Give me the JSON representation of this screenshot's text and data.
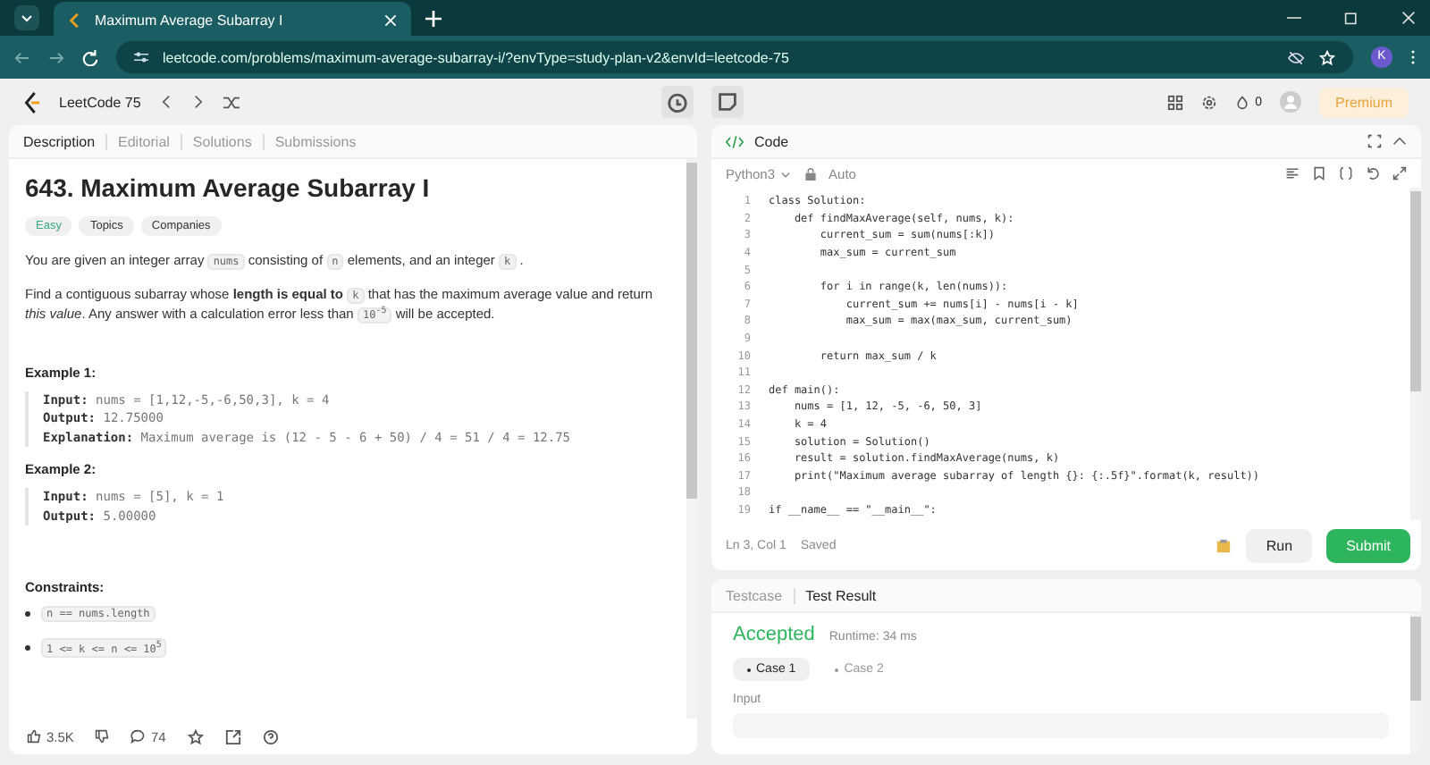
{
  "browser": {
    "tab_title": "Maximum Average Subarray I",
    "url": "leetcode.com/problems/maximum-average-subarray-i/?envType=study-plan-v2&envId=leetcode-75",
    "profile_initial": "K"
  },
  "nav": {
    "list_name": "LeetCode 75",
    "streak": "0",
    "premium": "Premium"
  },
  "left_tabs": [
    {
      "label": "Description",
      "selected": true
    },
    {
      "label": "Editorial",
      "selected": false
    },
    {
      "label": "Solutions",
      "selected": false
    },
    {
      "label": "Submissions",
      "selected": false
    }
  ],
  "problem": {
    "title": "643. Maximum Average Subarray I",
    "difficulty": "Easy",
    "tags": [
      "Topics",
      "Companies"
    ],
    "paragraphs": [
      [
        {
          "kind": "text",
          "text": "You are given an integer array"
        },
        {
          "kind": "code",
          "text": "nums"
        },
        {
          "kind": "text",
          "text": "consisting of"
        },
        {
          "kind": "code",
          "text": "n"
        },
        {
          "kind": "text",
          "text": "elements, and an integer"
        },
        {
          "kind": "code",
          "text": "k"
        },
        {
          "kind": "text",
          "text": "."
        }
      ],
      [
        {
          "kind": "text",
          "text": "Find a contiguous subarray whose **length is equal to**"
        },
        {
          "kind": "code",
          "text": "k"
        },
        {
          "kind": "text",
          "text": "that has the maximum average value and return *this value*. Any answer with a calculation error less than"
        },
        {
          "kind": "code",
          "text": "10$^{-5}$"
        },
        {
          "kind": "text",
          "text": "will be accepted."
        }
      ]
    ]
  },
  "examples": [
    {
      "title": "Example 1:",
      "lines": [
        {
          "label": "Input:",
          "value": "nums = [1,12,-5,-6,50,3], k = 4"
        },
        {
          "label": "Output:",
          "value": "12.75000"
        },
        {
          "label": "Explanation:",
          "value": "Maximum average is (12 - 5 - 6 + 50) / 4 = 51 / 4 = 12.75"
        }
      ]
    },
    {
      "title": "Example 2:",
      "lines": [
        {
          "label": "Input:",
          "value": "nums = [5], k = 1"
        },
        {
          "label": "Output:",
          "value": "5.00000"
        }
      ]
    }
  ],
  "constraints": {
    "title": "Constraints:",
    "items": [
      "n == nums.length",
      "1 <= k <= n <= 10$^{5}$"
    ]
  },
  "footer": {
    "likes": "3.5K",
    "comments": "74"
  },
  "code_panel": {
    "title": "Code",
    "language": "Python3",
    "mode": "Auto",
    "lines": [
      {
        "n": "1",
        "text": "class Solution:"
      },
      {
        "n": "2",
        "text": "    def findMaxAverage(self, nums, k):"
      },
      {
        "n": "3",
        "text": "        current_sum = sum(nums[:k])"
      },
      {
        "n": "4",
        "text": "        max_sum = current_sum"
      },
      {
        "n": "5"
      },
      {
        "n": "6",
        "text": "        for i in range(k, len(nums)):"
      },
      {
        "n": "7",
        "text": "            current_sum += nums[i] - nums[i - k]"
      },
      {
        "n": "8",
        "text": "            max_sum = max(max_sum, current_sum)"
      },
      {
        "n": "9"
      },
      {
        "n": "10",
        "text": "        return max_sum / k"
      },
      {
        "n": "11"
      },
      {
        "n": "12",
        "text": "def main():"
      },
      {
        "n": "13",
        "text": "    nums = [1, 12, -5, -6, 50, 3]"
      },
      {
        "n": "14",
        "text": "    k = 4"
      },
      {
        "n": "15",
        "text": "    solution = Solution()"
      },
      {
        "n": "16",
        "text": "    result = solution.findMaxAverage(nums, k)"
      },
      {
        "n": "17",
        "text": "    print(\"Maximum average subarray of length {}: {:.5f}\".format(k, result))"
      },
      {
        "n": "18"
      },
      {
        "n": "19",
        "text": "if __name__ == \"__main__\":"
      }
    ],
    "status": "Ln 3, Col 1",
    "saved": "Saved",
    "run": "Run",
    "submit": "Submit"
  },
  "result_panel": {
    "tabs": [
      {
        "label": "Testcase",
        "selected": false
      },
      {
        "label": "Test Result",
        "selected": true
      }
    ],
    "verdict": "Accepted",
    "runtime": "Runtime: 34 ms",
    "cases": [
      {
        "label": "Case 1",
        "selected": true
      },
      {
        "label": "Case 2",
        "selected": false
      }
    ],
    "input_label": "Input"
  }
}
